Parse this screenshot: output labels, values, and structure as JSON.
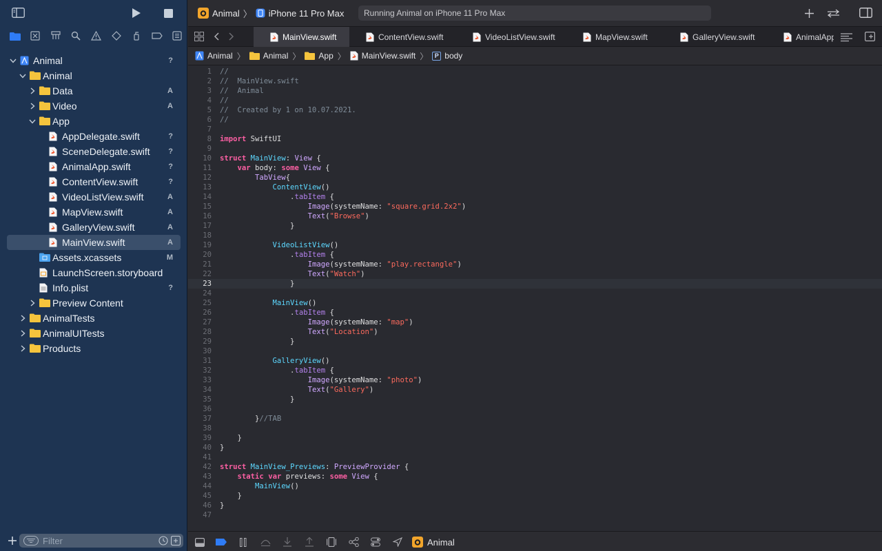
{
  "toolbar": {
    "scheme": "Animal",
    "destination": "iPhone 11 Pro Max",
    "activity_status": "Running Animal on iPhone 11 Pro Max"
  },
  "navigator": {
    "tree": [
      {
        "label": "Animal",
        "status": "?",
        "icon": "project",
        "depth": 0,
        "expanded": true
      },
      {
        "label": "Animal",
        "status": "",
        "icon": "folder",
        "depth": 1,
        "expanded": true
      },
      {
        "label": "Data",
        "status": "A",
        "icon": "folder",
        "depth": 2,
        "expanded": false
      },
      {
        "label": "Video",
        "status": "A",
        "icon": "folder",
        "depth": 2,
        "expanded": false
      },
      {
        "label": "App",
        "status": "",
        "icon": "folder",
        "depth": 2,
        "expanded": true
      },
      {
        "label": "AppDelegate.swift",
        "status": "?",
        "icon": "swift",
        "depth": 3
      },
      {
        "label": "SceneDelegate.swift",
        "status": "?",
        "icon": "swift",
        "depth": 3
      },
      {
        "label": "AnimalApp.swift",
        "status": "?",
        "icon": "swift",
        "depth": 3
      },
      {
        "label": "ContentView.swift",
        "status": "?",
        "icon": "swift",
        "depth": 3
      },
      {
        "label": "VideoListView.swift",
        "status": "A",
        "icon": "swift",
        "depth": 3
      },
      {
        "label": "MapView.swift",
        "status": "A",
        "icon": "swift",
        "depth": 3
      },
      {
        "label": "GalleryView.swift",
        "status": "A",
        "icon": "swift",
        "depth": 3
      },
      {
        "label": "MainView.swift",
        "status": "A",
        "icon": "swift",
        "depth": 3,
        "selected": true
      },
      {
        "label": "Assets.xcassets",
        "status": "M",
        "icon": "assets",
        "depth": 2
      },
      {
        "label": "LaunchScreen.storyboard",
        "status": "",
        "icon": "storyboard",
        "depth": 2
      },
      {
        "label": "Info.plist",
        "status": "?",
        "icon": "plist",
        "depth": 2
      },
      {
        "label": "Preview Content",
        "status": "",
        "icon": "folder",
        "depth": 2,
        "expanded": false
      },
      {
        "label": "AnimalTests",
        "status": "",
        "icon": "folder",
        "depth": 1,
        "expanded": false
      },
      {
        "label": "AnimalUITests",
        "status": "",
        "icon": "folder",
        "depth": 1,
        "expanded": false
      },
      {
        "label": "Products",
        "status": "",
        "icon": "folder",
        "depth": 1,
        "expanded": false
      }
    ],
    "filter_placeholder": "Filter"
  },
  "tabs": [
    {
      "label": "MainView.swift",
      "active": true
    },
    {
      "label": "ContentView.swift",
      "active": false
    },
    {
      "label": "VideoListView.swift",
      "active": false
    },
    {
      "label": "MapView.swift",
      "active": false
    },
    {
      "label": "GalleryView.swift",
      "active": false
    },
    {
      "label": "AnimalApp",
      "active": false
    }
  ],
  "breadcrumb": {
    "project": "Animal",
    "group": "Animal",
    "folder": "App",
    "file": "MainView.swift",
    "symbol_badge": "P",
    "symbol": "body"
  },
  "editor": {
    "current_line": 23,
    "lines": [
      [
        [
          "comment",
          "//"
        ]
      ],
      [
        [
          "comment",
          "//  MainView.swift"
        ]
      ],
      [
        [
          "comment",
          "//  Animal"
        ]
      ],
      [
        [
          "comment",
          "//"
        ]
      ],
      [
        [
          "comment",
          "//  Created by 1 on 10.07.2021."
        ]
      ],
      [
        [
          "comment",
          "//"
        ]
      ],
      [],
      [
        [
          "keyword",
          "import"
        ],
        [
          "plain",
          " SwiftUI"
        ]
      ],
      [],
      [
        [
          "keyword",
          "struct"
        ],
        [
          "plain",
          " "
        ],
        [
          "typedecl",
          "MainView"
        ],
        [
          "plain",
          ": "
        ],
        [
          "type",
          "View"
        ],
        [
          "plain",
          " {"
        ]
      ],
      [
        [
          "plain",
          "    "
        ],
        [
          "keyword",
          "var"
        ],
        [
          "plain",
          " body: "
        ],
        [
          "keyword",
          "some"
        ],
        [
          "plain",
          " "
        ],
        [
          "type",
          "View"
        ],
        [
          "plain",
          " {"
        ]
      ],
      [
        [
          "plain",
          "        "
        ],
        [
          "type",
          "TabView"
        ],
        [
          "plain",
          "{"
        ]
      ],
      [
        [
          "plain",
          "            "
        ],
        [
          "typedecl",
          "ContentView"
        ],
        [
          "plain",
          "()"
        ]
      ],
      [
        [
          "plain",
          "                ."
        ],
        [
          "prop",
          "tabItem"
        ],
        [
          "plain",
          " {"
        ]
      ],
      [
        [
          "plain",
          "                    "
        ],
        [
          "type",
          "Image"
        ],
        [
          "plain",
          "(systemName: "
        ],
        [
          "string",
          "\"square.grid.2x2\""
        ],
        [
          "plain",
          ")"
        ]
      ],
      [
        [
          "plain",
          "                    "
        ],
        [
          "type",
          "Text"
        ],
        [
          "plain",
          "("
        ],
        [
          "string",
          "\"Browse\""
        ],
        [
          "plain",
          ")"
        ]
      ],
      [
        [
          "plain",
          "                }"
        ]
      ],
      [],
      [
        [
          "plain",
          "            "
        ],
        [
          "typedecl",
          "VideoListView"
        ],
        [
          "plain",
          "()"
        ]
      ],
      [
        [
          "plain",
          "                ."
        ],
        [
          "prop",
          "tabItem"
        ],
        [
          "plain",
          " {"
        ]
      ],
      [
        [
          "plain",
          "                    "
        ],
        [
          "type",
          "Image"
        ],
        [
          "plain",
          "(systemName: "
        ],
        [
          "string",
          "\"play.rectangle\""
        ],
        [
          "plain",
          ")"
        ]
      ],
      [
        [
          "plain",
          "                    "
        ],
        [
          "type",
          "Text"
        ],
        [
          "plain",
          "("
        ],
        [
          "string",
          "\"Watch\""
        ],
        [
          "plain",
          ")"
        ]
      ],
      [
        [
          "plain",
          "                }"
        ]
      ],
      [],
      [
        [
          "plain",
          "            "
        ],
        [
          "typedecl",
          "MainView"
        ],
        [
          "plain",
          "()"
        ]
      ],
      [
        [
          "plain",
          "                ."
        ],
        [
          "prop",
          "tabItem"
        ],
        [
          "plain",
          " {"
        ]
      ],
      [
        [
          "plain",
          "                    "
        ],
        [
          "type",
          "Image"
        ],
        [
          "plain",
          "(systemName: "
        ],
        [
          "string",
          "\"map\""
        ],
        [
          "plain",
          ")"
        ]
      ],
      [
        [
          "plain",
          "                    "
        ],
        [
          "type",
          "Text"
        ],
        [
          "plain",
          "("
        ],
        [
          "string",
          "\"Location\""
        ],
        [
          "plain",
          ")"
        ]
      ],
      [
        [
          "plain",
          "                }"
        ]
      ],
      [],
      [
        [
          "plain",
          "            "
        ],
        [
          "typedecl",
          "GalleryView"
        ],
        [
          "plain",
          "()"
        ]
      ],
      [
        [
          "plain",
          "                ."
        ],
        [
          "prop",
          "tabItem"
        ],
        [
          "plain",
          " {"
        ]
      ],
      [
        [
          "plain",
          "                    "
        ],
        [
          "type",
          "Image"
        ],
        [
          "plain",
          "(systemName: "
        ],
        [
          "string",
          "\"photo\""
        ],
        [
          "plain",
          ")"
        ]
      ],
      [
        [
          "plain",
          "                    "
        ],
        [
          "type",
          "Text"
        ],
        [
          "plain",
          "("
        ],
        [
          "string",
          "\"Gallery\""
        ],
        [
          "plain",
          ")"
        ]
      ],
      [
        [
          "plain",
          "                }"
        ]
      ],
      [],
      [
        [
          "plain",
          "        }"
        ],
        [
          "comment",
          "//TAB"
        ]
      ],
      [],
      [
        [
          "plain",
          "    }"
        ]
      ],
      [
        [
          "plain",
          "}"
        ]
      ],
      [],
      [
        [
          "keyword",
          "struct"
        ],
        [
          "plain",
          " "
        ],
        [
          "typedecl",
          "MainView_Previews"
        ],
        [
          "plain",
          ": "
        ],
        [
          "type",
          "PreviewProvider"
        ],
        [
          "plain",
          " {"
        ]
      ],
      [
        [
          "plain",
          "    "
        ],
        [
          "keyword",
          "static"
        ],
        [
          "plain",
          " "
        ],
        [
          "keyword",
          "var"
        ],
        [
          "plain",
          " previews: "
        ],
        [
          "keyword",
          "some"
        ],
        [
          "plain",
          " "
        ],
        [
          "type",
          "View"
        ],
        [
          "plain",
          " {"
        ]
      ],
      [
        [
          "plain",
          "        "
        ],
        [
          "typedecl",
          "MainView"
        ],
        [
          "plain",
          "()"
        ]
      ],
      [
        [
          "plain",
          "    }"
        ]
      ],
      [
        [
          "plain",
          "}"
        ]
      ],
      []
    ]
  },
  "debug": {
    "process": "Animal"
  },
  "colors": {
    "sidebar_bg": "#1e3452",
    "editor_bg": "#292a30",
    "keyword": "#fc5fa3",
    "string": "#fc6a5d",
    "type": "#d0a8ff",
    "comment": "#7f8c98",
    "folder": "#f5c43d",
    "accent": "#2f7cf6"
  }
}
